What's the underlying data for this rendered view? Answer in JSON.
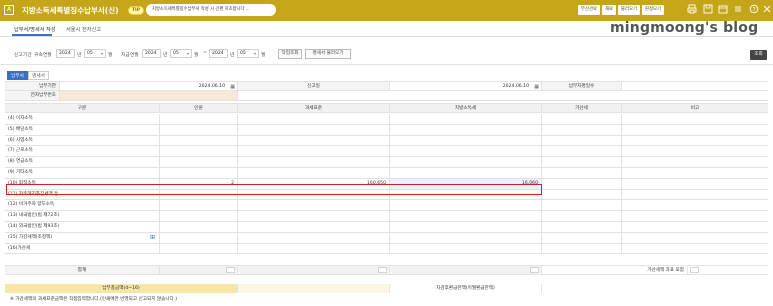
{
  "window": {
    "app_title": "지방소득세특별징수납부서(신)",
    "tip_label": "TIP",
    "tip_text": "지방소득세특별징수납부서 작성 시 간편 지조합니다 ...",
    "buttons": [
      "부산관료",
      "재료",
      "불러오기",
      "원정모기"
    ]
  },
  "tabs": [
    "납부서/명세서 작성",
    "서울시 전자신고"
  ],
  "watermark": "mingmoong's blog",
  "filter": {
    "period_label": "신고기간",
    "attribution_label": "귀속연월",
    "attr_year": "2024",
    "attr_year_unit": "년",
    "attr_month": "05",
    "attr_month_unit": "월",
    "pay_label": "지급연월",
    "pay_year": "2024",
    "pay_year_unit": "년",
    "pay_month": "05",
    "pay_month_unit": "월",
    "tilde": "~",
    "end_year": "2024",
    "end_year_unit": "년",
    "end_month": "05",
    "end_month_unit": "월",
    "fetch_button": "작업조회",
    "load_button": "명세서 불러오기",
    "search_button": "조회"
  },
  "subtabs": [
    "납부서",
    "명세서"
  ],
  "info": {
    "due_label": "납부기한",
    "due_value": "2024.06.10",
    "report_label": "신고일",
    "report_value": "2024.06.10",
    "count_label": "납부자명일수",
    "ebill_label": "전자납부번호"
  },
  "table": {
    "headers": [
      "구분",
      "인원",
      "과세표준",
      "지방소득세",
      "가산세",
      "비고"
    ],
    "rows": [
      {
        "label": "(4) 이자소득",
        "people": "",
        "base": "",
        "tax": ""
      },
      {
        "label": "(5) 배당소득",
        "people": "",
        "base": "",
        "tax": ""
      },
      {
        "label": "(6) 사업소득",
        "people": "",
        "base": "",
        "tax": ""
      },
      {
        "label": "(7) 근로소득",
        "people": "",
        "base": "",
        "tax": ""
      },
      {
        "label": "(8) 연금소득",
        "people": "",
        "base": "",
        "tax": ""
      },
      {
        "label": "(9) 기타소득",
        "people": "",
        "base": "",
        "tax": ""
      },
      {
        "label": "(10) 퇴직소득",
        "people": "2",
        "base": "160,650",
        "tax": "16,060"
      },
      {
        "label": "(11) 저축해지추징세액 등",
        "people": "",
        "base": "",
        "tax": ""
      },
      {
        "label": "(12) 비거주자 양도소득",
        "people": "",
        "base": "",
        "tax": ""
      },
      {
        "label": "(13) 내국법인(법 제72조)",
        "people": "",
        "base": "",
        "tax": ""
      },
      {
        "label": "(14) 외국법인(법 제93조)",
        "people": "",
        "base": "",
        "tax": ""
      },
      {
        "label": "(15) 가감세액(조정액)",
        "people": "",
        "base": "",
        "tax": ""
      },
      {
        "label": "(16)가산세",
        "people": "",
        "base": "",
        "tax": ""
      }
    ],
    "total_label": "합계",
    "penalty_include_label": "가산세액 과표 포함"
  },
  "bottom": {
    "paid_total_label": "납부총금액(4~16)",
    "refund_label": "차감후환급잔액(이월환급잔액)",
    "note": "※ 가감세액의 과세표준금액은 직접입력합니다.(인쇄에만 반영되고 신고되지 않습니다.)"
  },
  "colors": {
    "title_bar": "#c5a51a",
    "accent_blue": "#3a6fc1",
    "highlight_red": "#d42020",
    "total_bar": "#f6e7a6"
  }
}
